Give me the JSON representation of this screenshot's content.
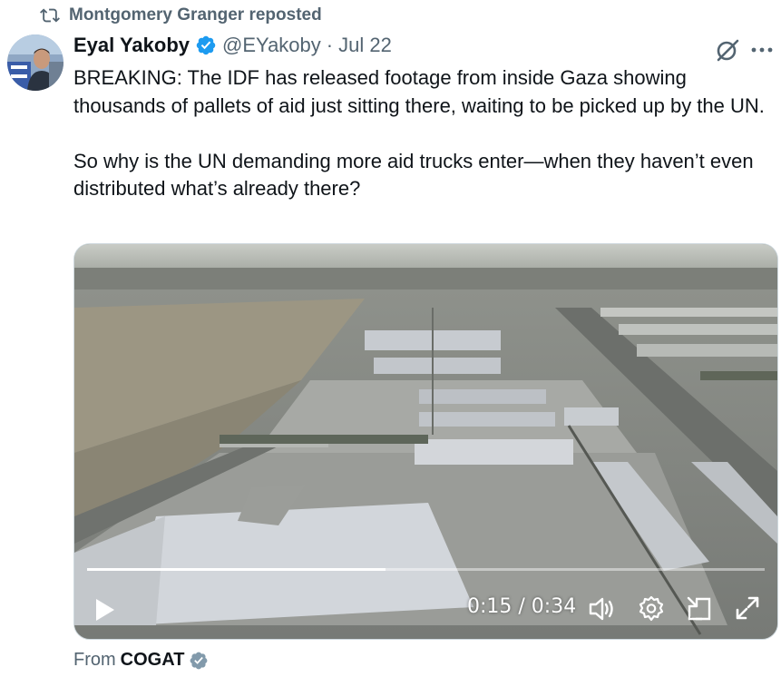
{
  "repost": {
    "label": "Montgomery Granger reposted",
    "icon": "repost-icon"
  },
  "author": {
    "display_name": "Eyal Yakoby",
    "handle": "@EYakoby",
    "separator": "·",
    "date": "Jul 22",
    "verified_color": "#1d9bf0"
  },
  "tweet": {
    "text": "BREAKING: The IDF has released footage from inside Gaza showing thousands of pallets of aid just sitting there, waiting to be picked up by the UN.\n\nSo why is the UN demanding more aid trucks enter—when they haven’t even distributed what’s already there?"
  },
  "video": {
    "current_time": "0:15",
    "duration": "0:34",
    "time_display": "0:15 / 0:34",
    "progress": 0.44
  },
  "source": {
    "prefix": "From",
    "name": "COGAT",
    "verified_color": "#829aab"
  },
  "icons": [
    "grok-icon",
    "more-icon",
    "play-icon",
    "volume-icon",
    "settings-icon",
    "pip-icon",
    "fullscreen-icon"
  ]
}
